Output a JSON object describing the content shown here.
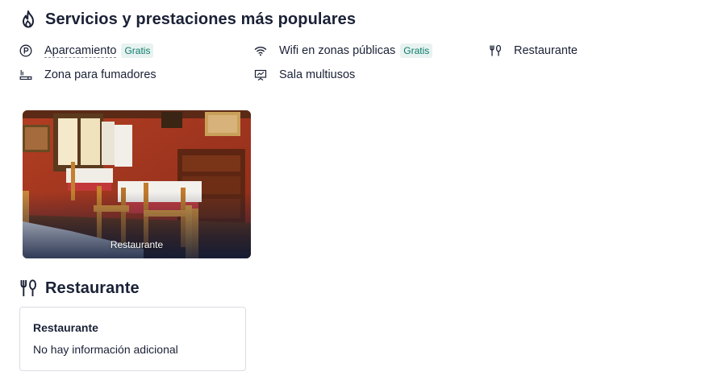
{
  "popular": {
    "title": "Servicios y prestaciones más populares",
    "icon": "flame-icon",
    "amenities": [
      {
        "label": "Aparcamiento",
        "icon": "parking-icon",
        "badge": "Gratis"
      },
      {
        "label": "Wifi en zonas públicas",
        "icon": "wifi-icon",
        "badge": "Gratis"
      },
      {
        "label": "Restaurante",
        "icon": "cutlery-icon"
      },
      {
        "label": "Zona para fumadores",
        "icon": "smoking-icon"
      },
      {
        "label": "Sala multiusos",
        "icon": "presentation-icon"
      }
    ]
  },
  "photo": {
    "caption": "Restaurante"
  },
  "restaurant_section": {
    "title": "Restaurante",
    "icon": "cutlery-icon",
    "card": {
      "title": "Restaurante",
      "text": "No hay información adicional"
    }
  },
  "colors": {
    "text": "#1a2136",
    "badge_bg": "#e8f3f1",
    "badge_text": "#0a7a6a",
    "card_border": "#d9dce3"
  }
}
